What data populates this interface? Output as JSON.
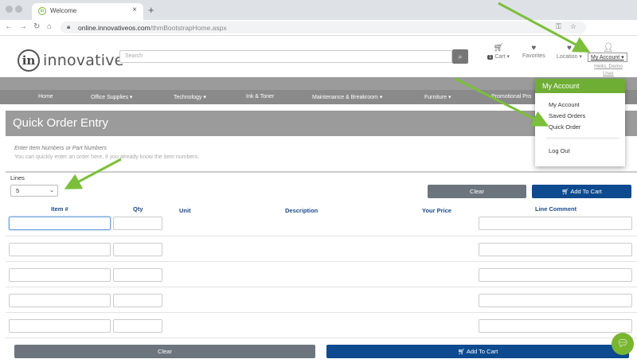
{
  "browser": {
    "tab_title": "Welcome",
    "tab_favicon": "in",
    "new_tab_icon": "+",
    "close_icon": "×",
    "url_domain": "online.innovativeos.com",
    "url_path": "/thmBootstrapHome.aspx"
  },
  "site": {
    "logo_mark": "in",
    "logo_word": "innovative",
    "search_placeholder": "Search",
    "cart_label": "Cart",
    "cart_count": "1",
    "favorites_label": "Favorites",
    "location_label": "Location",
    "my_account_label": "My Account",
    "hello_text": "Hello, Demo User"
  },
  "nav": {
    "items": [
      "Home",
      "Office Supplies",
      "Technology",
      "Ink & Toner",
      "Maintenance & Breakroom",
      "Furniture",
      "Promotional Pro"
    ]
  },
  "account_menu": {
    "header": "My Account",
    "items": [
      "My Account",
      "Saved Orders",
      "Quick Order",
      "Log Out"
    ]
  },
  "page": {
    "title": "Quick Order Entry",
    "hint_line1": "Enter Item Numbers or Part Numbers",
    "hint_line2": "You can quickly enter an order here, if you already know the item numbers.",
    "lines_label": "Lines",
    "lines_value": "5",
    "clear_label": "Clear",
    "add_to_cart_label": "Add To Cart",
    "columns": [
      "Item #",
      "Qty",
      "Unit",
      "Description",
      "Your Price",
      "Line Comment"
    ]
  },
  "colors": {
    "accent_green": "#6fae34",
    "button_blue": "#0d4a8f",
    "button_grey": "#6c757d",
    "arrow_green": "#7bbf3a"
  }
}
